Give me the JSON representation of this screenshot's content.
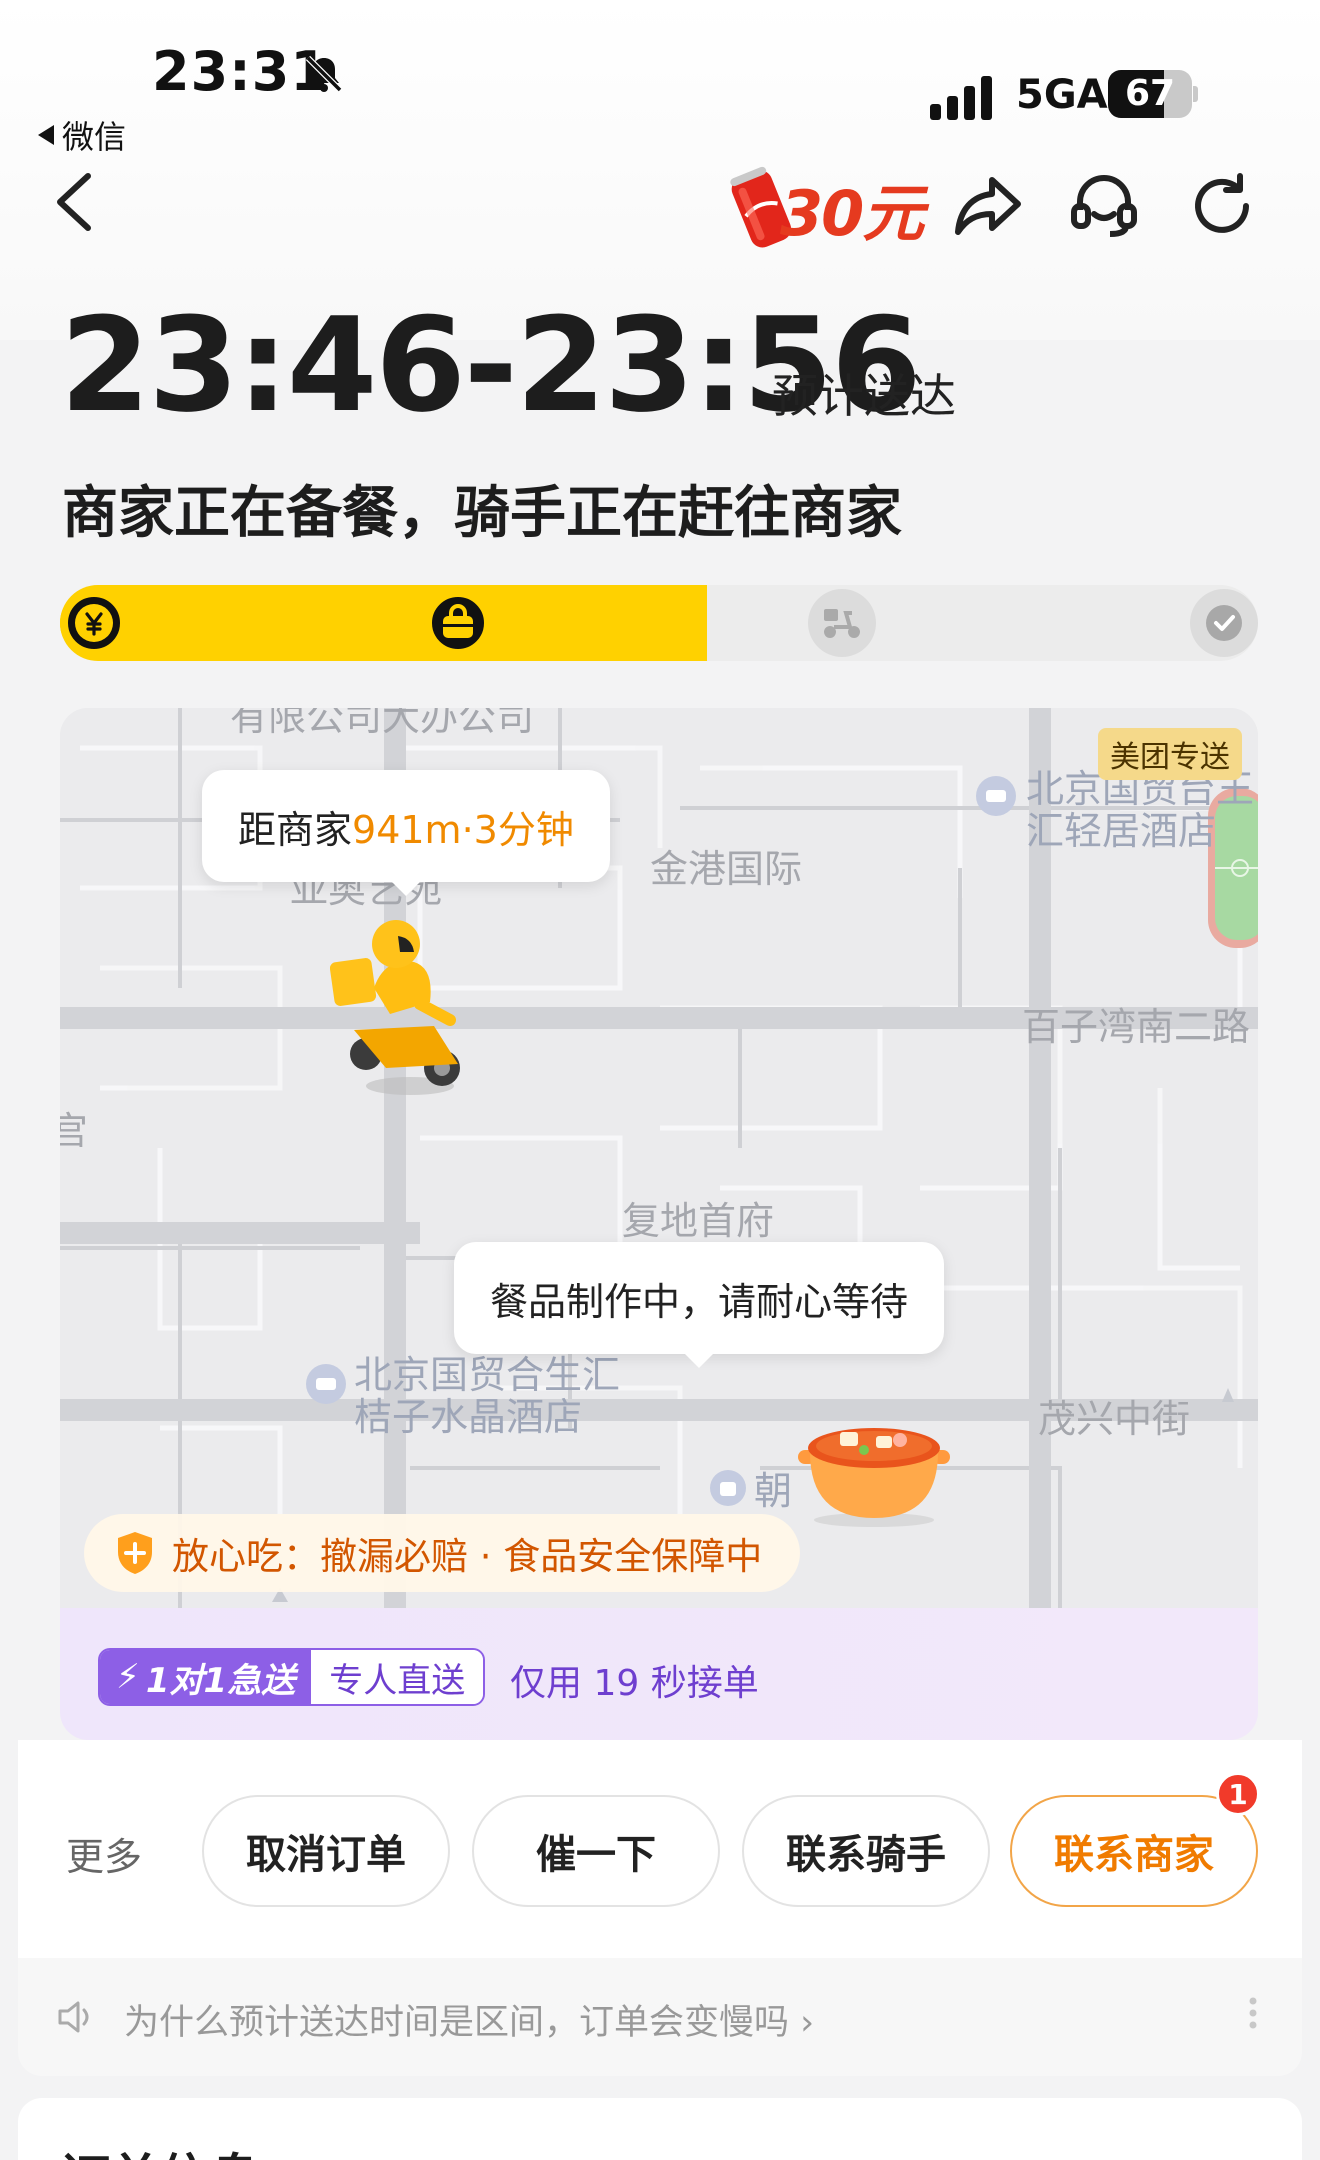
{
  "status_bar": {
    "time": "23:31",
    "back_app": "微信",
    "network": "5GA",
    "battery": "67",
    "battery_level": 0.67
  },
  "nav": {
    "promo": "30元",
    "icons": [
      "back-icon",
      "share-icon",
      "customer-service-icon",
      "refresh-icon"
    ]
  },
  "eta": {
    "time_range": "23:46-23:56",
    "label": "预计送达"
  },
  "status_line": "商家正在备餐，骑手正在赶往商家",
  "progress": {
    "fraction": 0.54,
    "steps": [
      "paid",
      "merchant-preparing",
      "rider-delivering",
      "delivered"
    ],
    "current_step": 1
  },
  "map": {
    "brand_tag": "美团专送",
    "rider_bubble": {
      "prefix": "距商家",
      "distance": "941m·3分钟"
    },
    "store_bubble": "餐品制作中，请耐心等待",
    "labels": {
      "top_partial": "有限公司大办公司",
      "hotel_ne_line1": "北京国贸台王",
      "hotel_ne_line2": "汇轻居酒店",
      "jingang": "金港国际",
      "baizi": "百子湾南二路",
      "fudi": "复地首府",
      "hotel_sw_line1": "北京国贸合生汇",
      "hotel_sw_line2": "桔子水晶酒店",
      "maoxing": "茂兴中街",
      "chao": "朝",
      "partial_left": "宫",
      "partial_rider": "亚奥艺苑"
    },
    "safety_banner": "放心吃：撤漏必赔 · 食品安全保障中"
  },
  "express": {
    "badge_left": "1对1急送",
    "badge_right": "专人直送",
    "note": "仅用 19 秒接单"
  },
  "actions": {
    "more": "更多",
    "cancel": "取消订单",
    "urge": "催一下",
    "contact_rider": "联系骑手",
    "contact_merchant": "联系商家",
    "merchant_badge": "1"
  },
  "faq": "为什么预计送达时间是区间，订单会变慢吗 ›",
  "order_info_title": "订单信息",
  "colors": {
    "accent_yellow": "#ffd100",
    "orange": "#f07b00",
    "purple": "#8d5fe6",
    "badge_red": "#f13a2a"
  }
}
